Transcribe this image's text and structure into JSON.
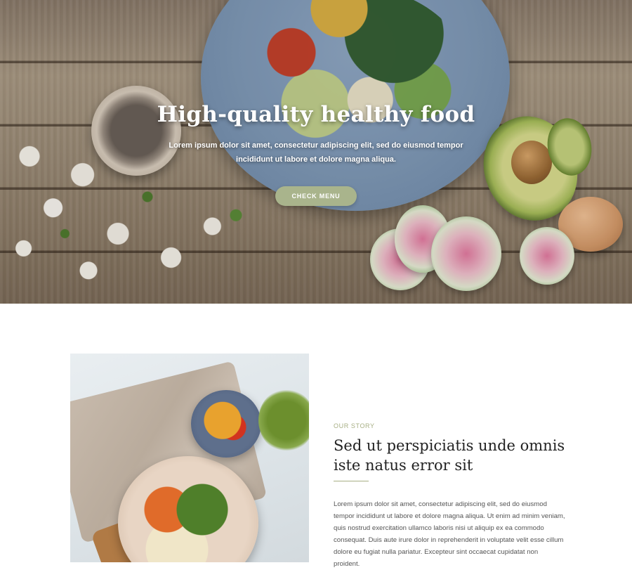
{
  "hero": {
    "title": "High-quality healthy food",
    "text": "Lorem ipsum dolor sit amet, consectetur adipiscing elit, sed do eiusmod tempor incididunt ut labore et dolore magna aliqua.",
    "button_label": "CHECK MENU",
    "button_color": "#a9b48c"
  },
  "story": {
    "kicker": "OUR STORY",
    "heading": "Sed ut perspiciatis unde omnis iste natus error sit",
    "body": "Lorem ipsum dolor sit amet, consectetur adipiscing elit, sed do eiusmod tempor incididunt ut labore et dolore magna aliqua. Ut enim ad minim veniam, quis nostrud exercitation ullamco laboris nisi ut aliquip ex ea commodo consequat. Duis aute irure dolor in reprehenderit in voluptate velit esse cillum dolore eu fugiat nulla pariatur. Excepteur sint occaecat cupidatat non proident.",
    "accent_color": "#a7af84"
  }
}
